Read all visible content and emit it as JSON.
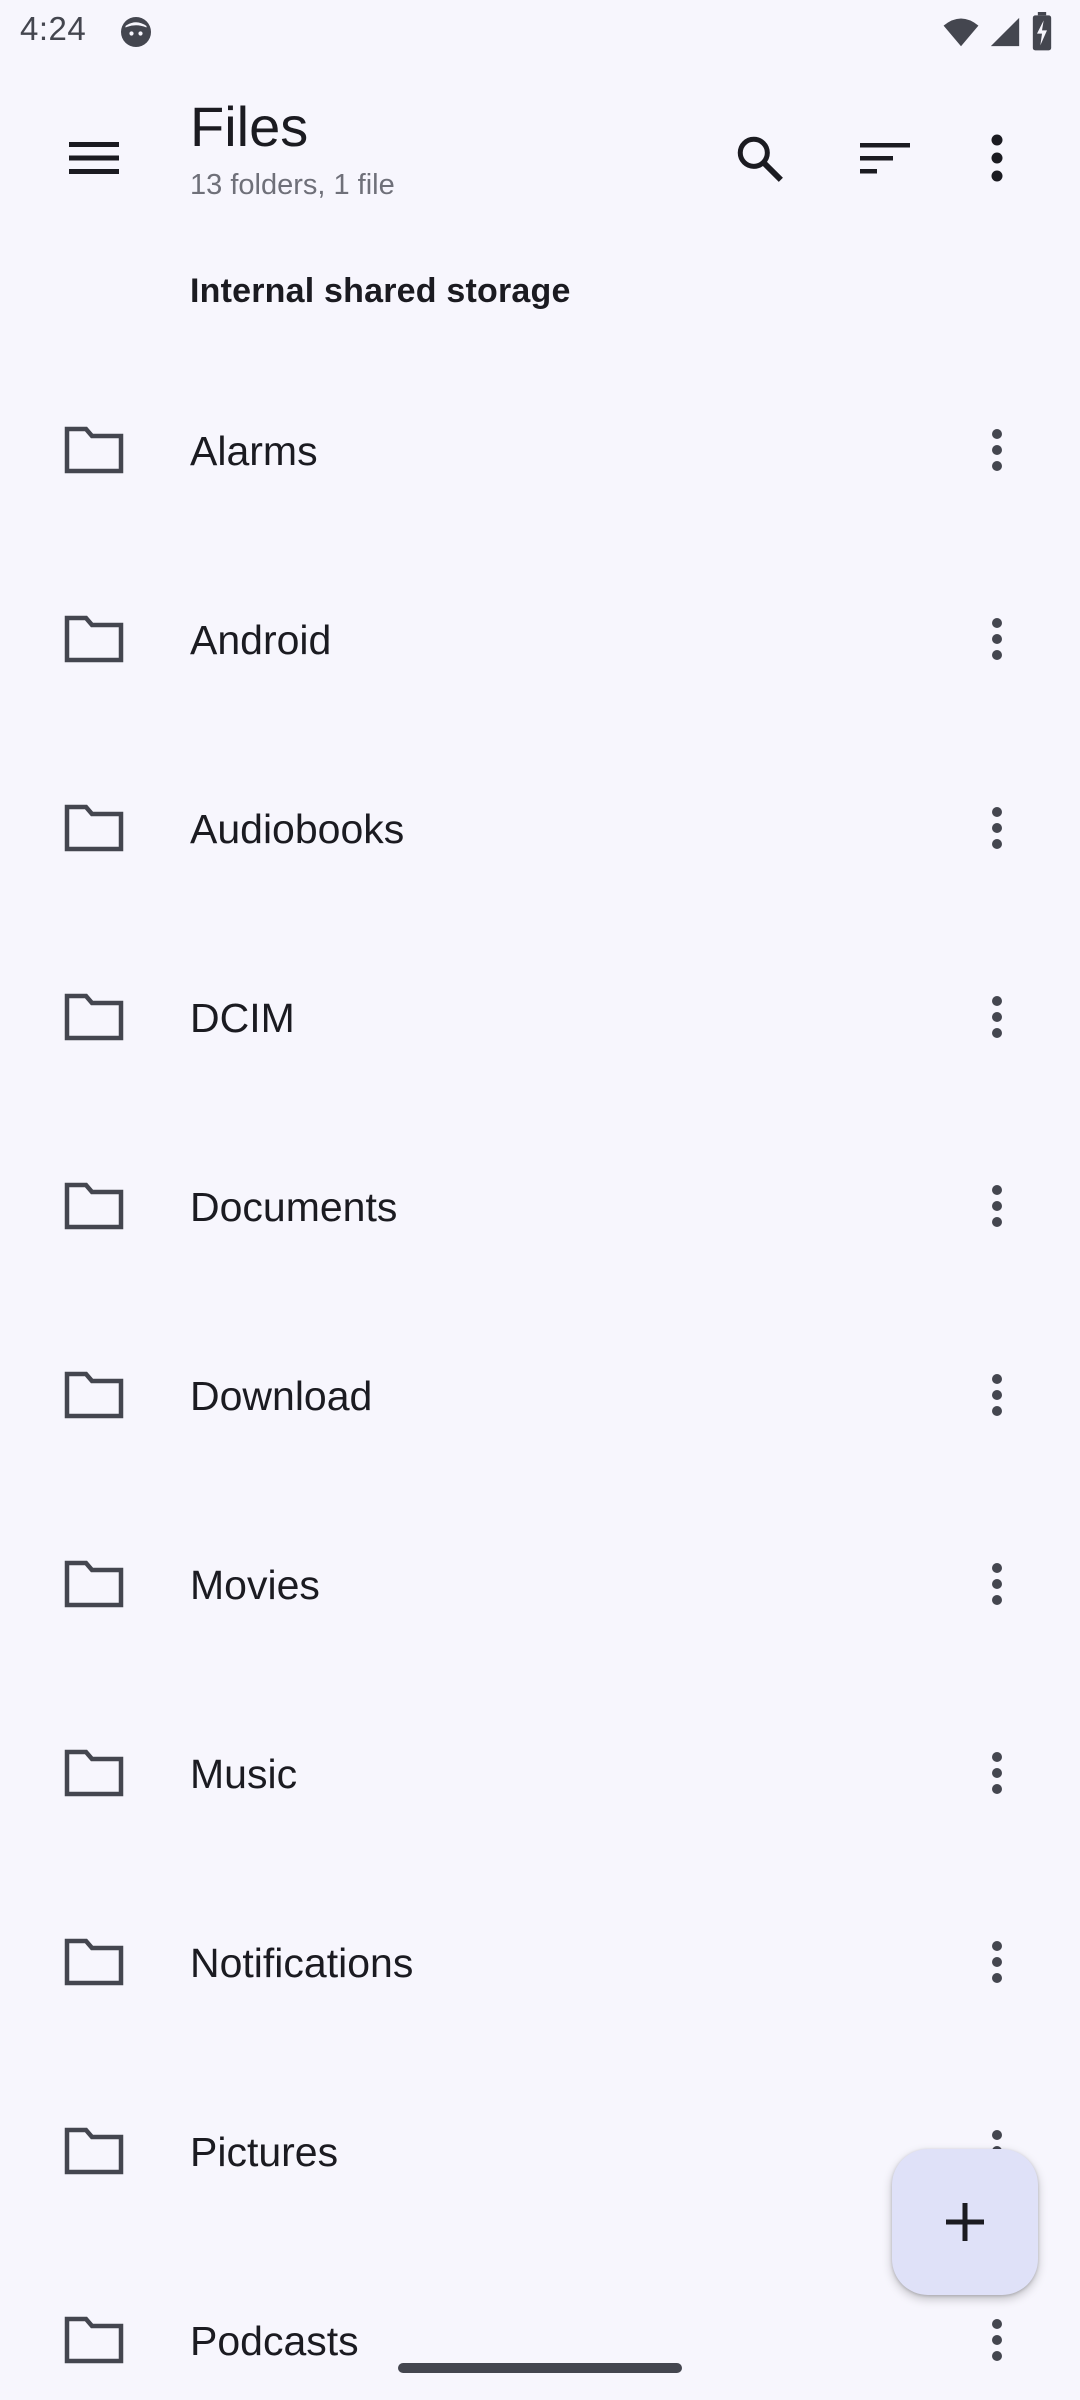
{
  "status_bar": {
    "time": "4:24",
    "icons": [
      "notification-face-icon",
      "wifi-icon",
      "cell-signal-icon",
      "battery-charging-icon"
    ]
  },
  "app_bar": {
    "title": "Files",
    "subtitle": "13 folders, 1 file",
    "actions": [
      "search-icon",
      "sort-icon",
      "more-vert-icon"
    ]
  },
  "section": {
    "header": "Internal shared storage"
  },
  "files": [
    {
      "name": "Alarms",
      "type": "folder"
    },
    {
      "name": "Android",
      "type": "folder"
    },
    {
      "name": "Audiobooks",
      "type": "folder"
    },
    {
      "name": "DCIM",
      "type": "folder"
    },
    {
      "name": "Documents",
      "type": "folder"
    },
    {
      "name": "Download",
      "type": "folder"
    },
    {
      "name": "Movies",
      "type": "folder"
    },
    {
      "name": "Music",
      "type": "folder"
    },
    {
      "name": "Notifications",
      "type": "folder"
    },
    {
      "name": "Pictures",
      "type": "folder"
    },
    {
      "name": "Podcasts",
      "type": "folder"
    }
  ],
  "fab": {
    "icon": "add-icon"
  },
  "colors": {
    "background": "#f7f6fd",
    "text_primary": "#1b1b21",
    "text_secondary": "#6f7079",
    "icon": "#44464f",
    "fab_background": "#dfe1f8"
  }
}
